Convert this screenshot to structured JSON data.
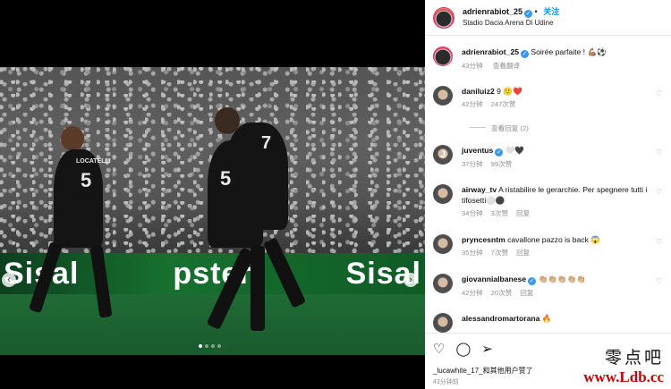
{
  "post": {
    "author": "adrienrabiot_25",
    "follow_label": "关注",
    "location": "Stadio Dacia Arena Di Udine"
  },
  "media": {
    "adboard_left": "Sisal",
    "adboard_mid": "pster",
    "adboard_right": "Sisal",
    "left_player_name": "LOCATELLI",
    "left_player_number": "5",
    "hug_player_number": "5",
    "hug_player_number_2": "7",
    "slide_count": 4,
    "active_slide": 1,
    "prev_icon": "chevron-left-icon",
    "next_icon": "chevron-right-icon"
  },
  "caption": {
    "username": "adrienrabiot_25",
    "text": "Soirée parfaite ! 💪🏽⚽",
    "time": "43分钟",
    "translate": "查看翻译"
  },
  "comments": [
    {
      "username": "daniluiz2",
      "text": "9 🙂❤️",
      "time": "42分钟",
      "likes": "247次赞",
      "reply": ""
    },
    {
      "username": "juventus",
      "text": "🤍🖤",
      "time": "37分钟",
      "likes": "99次赞",
      "reply": ""
    },
    {
      "username": "airway_tv",
      "text": "A ristabilire le gerarchie. Per spegnere tutti i tifosetti⚪⚫",
      "time": "34分钟",
      "likes": "3次赞",
      "reply": "回复"
    },
    {
      "username": "pryncesntm",
      "text": "cavallone pazzo is back 😱",
      "time": "35分钟",
      "likes": "7次赞",
      "reply": "回复"
    },
    {
      "username": "giovannialbanese",
      "text": "👏🏼👏🏼👏🏼👏🏼👏🏼",
      "time": "42分钟",
      "likes": "20次赞",
      "reply": "回复"
    },
    {
      "username": "alessandromartorana",
      "text": "🔥",
      "time": "",
      "likes": "",
      "reply": ""
    }
  ],
  "view_replies": "查看回复 (2)",
  "actions": {
    "like_icon": "heart-icon",
    "comment_icon": "comment-icon",
    "share_icon": "send-icon",
    "liked_by": "_lucawhite_17_和其他用户赞了",
    "time": "43分钟前"
  },
  "watermark": {
    "cn": "零点吧",
    "url": "www.Ldb.cc"
  },
  "colors": {
    "accent": "#0095f6",
    "verified": "#3897f0",
    "red": "#c40000"
  }
}
